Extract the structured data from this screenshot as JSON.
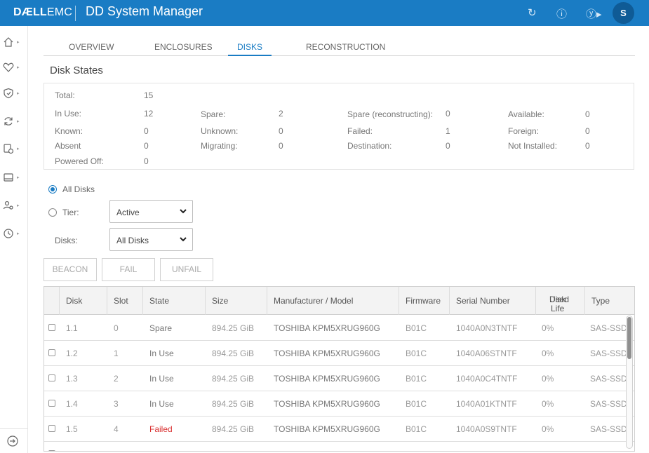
{
  "header": {
    "brand_dell": "DÆLL",
    "brand_emc": "EMC",
    "title": "DD System Manager",
    "avatar": "S"
  },
  "tabs": [
    {
      "label": "OVERVIEW"
    },
    {
      "label": "ENCLOSURES"
    },
    {
      "label": "DISKS"
    },
    {
      "label": "RECONSTRUCTION"
    }
  ],
  "section_title": "Disk States",
  "states": {
    "total_label": "Total:",
    "total_value": "15",
    "in_use_label": "In Use:",
    "in_use_value": "12",
    "spare_label": "Spare:",
    "spare_value": "2",
    "spare_recon_label": "Spare (reconstructing):",
    "spare_recon_value": "0",
    "available_label": "Available:",
    "available_value": "0",
    "known_label": "Known:",
    "known_value": "0",
    "unknown_label": "Unknown:",
    "unknown_value": "0",
    "failed_label": "Failed:",
    "failed_value": "1",
    "foreign_label": "Foreign:",
    "foreign_value": "0",
    "absent_label": "Absent",
    "absent_value": "0",
    "migrating_label": "Migrating:",
    "migrating_value": "0",
    "destination_label": "Destination:",
    "destination_value": "0",
    "not_installed_label": "Not Installed:",
    "not_installed_value": "0",
    "powered_off_label": "Powered Off:",
    "powered_off_value": "0"
  },
  "filters": {
    "all_disks_label": "All Disks",
    "tier_label": "Tier:",
    "tier_value": "Active",
    "disks_label": "Disks:",
    "disks_value": "All Disks"
  },
  "buttons": {
    "beacon": "BEACON",
    "fail": "FAIL",
    "unfail": "UNFAIL"
  },
  "table": {
    "columns": {
      "disk": "Disk",
      "slot": "Slot",
      "state": "State",
      "size": "Size",
      "model": "Manufacturer / Model",
      "firmware": "Firmware",
      "serial": "Serial Number",
      "life_1": "Disk Life",
      "life_2": "Used",
      "type": "Type"
    },
    "rows": [
      {
        "disk": "1.1",
        "slot": "0",
        "state": "Spare",
        "size": "894.25 GiB",
        "model": "TOSHIBA KPM5XRUG960G",
        "firmware": "B01C",
        "serial": "1040A0N3TNTF",
        "life": "0%",
        "type": "SAS-SSD"
      },
      {
        "disk": "1.2",
        "slot": "1",
        "state": "In Use",
        "size": "894.25 GiB",
        "model": "TOSHIBA KPM5XRUG960G",
        "firmware": "B01C",
        "serial": "1040A06STNTF",
        "life": "0%",
        "type": "SAS-SSD"
      },
      {
        "disk": "1.3",
        "slot": "2",
        "state": "In Use",
        "size": "894.25 GiB",
        "model": "TOSHIBA KPM5XRUG960G",
        "firmware": "B01C",
        "serial": "1040A0C4TNTF",
        "life": "0%",
        "type": "SAS-SSD"
      },
      {
        "disk": "1.4",
        "slot": "3",
        "state": "In Use",
        "size": "894.25 GiB",
        "model": "TOSHIBA KPM5XRUG960G",
        "firmware": "B01C",
        "serial": "1040A01KTNTF",
        "life": "0%",
        "type": "SAS-SSD"
      },
      {
        "disk": "1.5",
        "slot": "4",
        "state": "Failed",
        "size": "894.25 GiB",
        "model": "TOSHIBA KPM5XRUG960G",
        "firmware": "B01C",
        "serial": "1040A0S9TNTF",
        "life": "0%",
        "type": "SAS-SSD"
      }
    ]
  },
  "colors": {
    "header_bg": "#1a7cc4",
    "accent": "#1a7cc4",
    "failed": "#d93030"
  },
  "icons": [
    "home-icon",
    "heart-icon",
    "shield-icon",
    "refresh-icon",
    "settings-icon",
    "storage-icon",
    "users-icon",
    "clock-icon",
    "expand-icon",
    "help-icon",
    "info-icon",
    "reload-icon",
    "chevron-down-icon"
  ]
}
